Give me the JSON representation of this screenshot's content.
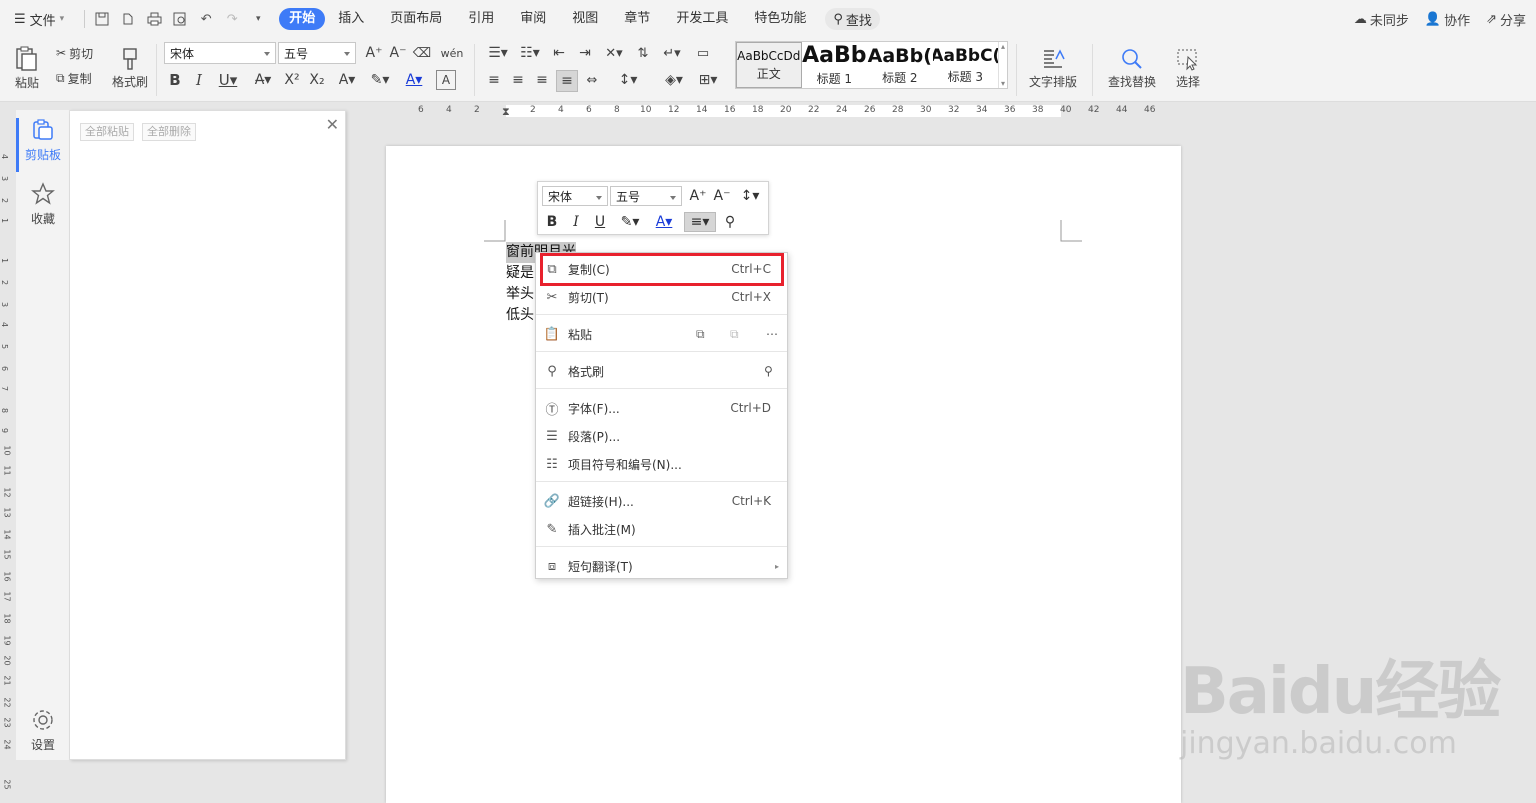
{
  "menubar": {
    "file_label": "文件",
    "tabs": [
      "开始",
      "插入",
      "页面布局",
      "引用",
      "审阅",
      "视图",
      "章节",
      "开发工具",
      "特色功能"
    ],
    "search_label": "查找",
    "right": {
      "sync": "未同步",
      "collab": "协作",
      "share": "分享"
    }
  },
  "ribbon": {
    "paste": "粘贴",
    "cut": "剪切",
    "copy": "复制",
    "format_painter": "格式刷",
    "font_name": "宋体",
    "font_size": "五号",
    "styles": [
      {
        "preview": "AaBbCcDd",
        "label": "正文"
      },
      {
        "preview": "AaBb",
        "label": "标题 1"
      },
      {
        "preview": "AaBb(",
        "label": "标题 2"
      },
      {
        "preview": "AaBbC(",
        "label": "标题 3"
      }
    ],
    "text_layout": "文字排版",
    "find_replace": "查找替换",
    "select": "选择"
  },
  "hruler": [
    "6",
    "4",
    "2",
    "2",
    "2",
    "4",
    "6",
    "8",
    "10",
    "12",
    "14",
    "16",
    "18",
    "20",
    "22",
    "24",
    "26",
    "28",
    "30",
    "32",
    "34",
    "36",
    "38",
    "40",
    "42",
    "44",
    "46"
  ],
  "vruler": [
    "4",
    "3",
    "2",
    "1",
    "1",
    "2",
    "3",
    "4",
    "5",
    "6",
    "7",
    "8",
    "9",
    "10",
    "11",
    "12",
    "13",
    "14",
    "15",
    "16",
    "17",
    "18",
    "19",
    "20",
    "21",
    "22",
    "23",
    "24",
    "25"
  ],
  "side_nav": {
    "clipboard": "剪贴板",
    "favorites": "收藏",
    "settings": "设置"
  },
  "panel": {
    "paste_all": "全部粘贴",
    "delete_all": "全部删除"
  },
  "document": {
    "lines": [
      "窗前明月光",
      "疑是",
      "举头",
      "低头"
    ]
  },
  "mini_toolbar": {
    "font_name": "宋体",
    "font_size": "五号"
  },
  "context_menu": {
    "copy": {
      "label": "复制(C)",
      "shortcut": "Ctrl+C"
    },
    "cut": {
      "label": "剪切(T)",
      "shortcut": "Ctrl+X"
    },
    "paste": {
      "label": "粘贴"
    },
    "format_painter": {
      "label": "格式刷"
    },
    "font": {
      "label": "字体(F)...",
      "shortcut": "Ctrl+D"
    },
    "paragraph": {
      "label": "段落(P)..."
    },
    "bullets": {
      "label": "项目符号和编号(N)..."
    },
    "hyperlink": {
      "label": "超链接(H)...",
      "shortcut": "Ctrl+K"
    },
    "comment": {
      "label": "插入批注(M)"
    },
    "translate": {
      "label": "短句翻译(T)"
    }
  },
  "watermark": {
    "brand": "Baidu经验",
    "url": "jingyan.baidu.com"
  },
  "colors": {
    "accent": "#3e7bf7",
    "highlight": "#e8212d"
  }
}
